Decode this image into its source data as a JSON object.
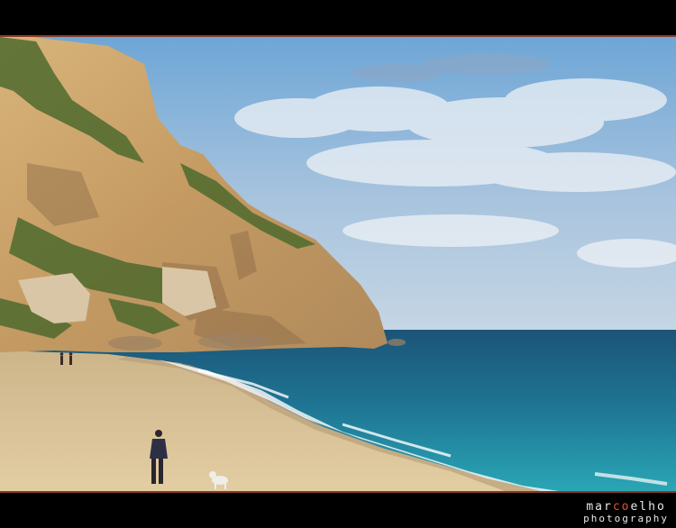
{
  "photo": {
    "subject": "coastal-cliff-beach",
    "colors": {
      "sky_top": "#7fb0d8",
      "sky_bottom": "#c9d9e6",
      "sea_deep": "#1d5f83",
      "sea_shallow": "#2aa3b3",
      "sand": "#d8c398",
      "cliff": "#c9a46c",
      "frame_line": "#8a3a24"
    }
  },
  "watermark": {
    "line1_prefix": "mar",
    "line1_accent": "co",
    "line1_suffix": "elho",
    "line2": "photography"
  }
}
